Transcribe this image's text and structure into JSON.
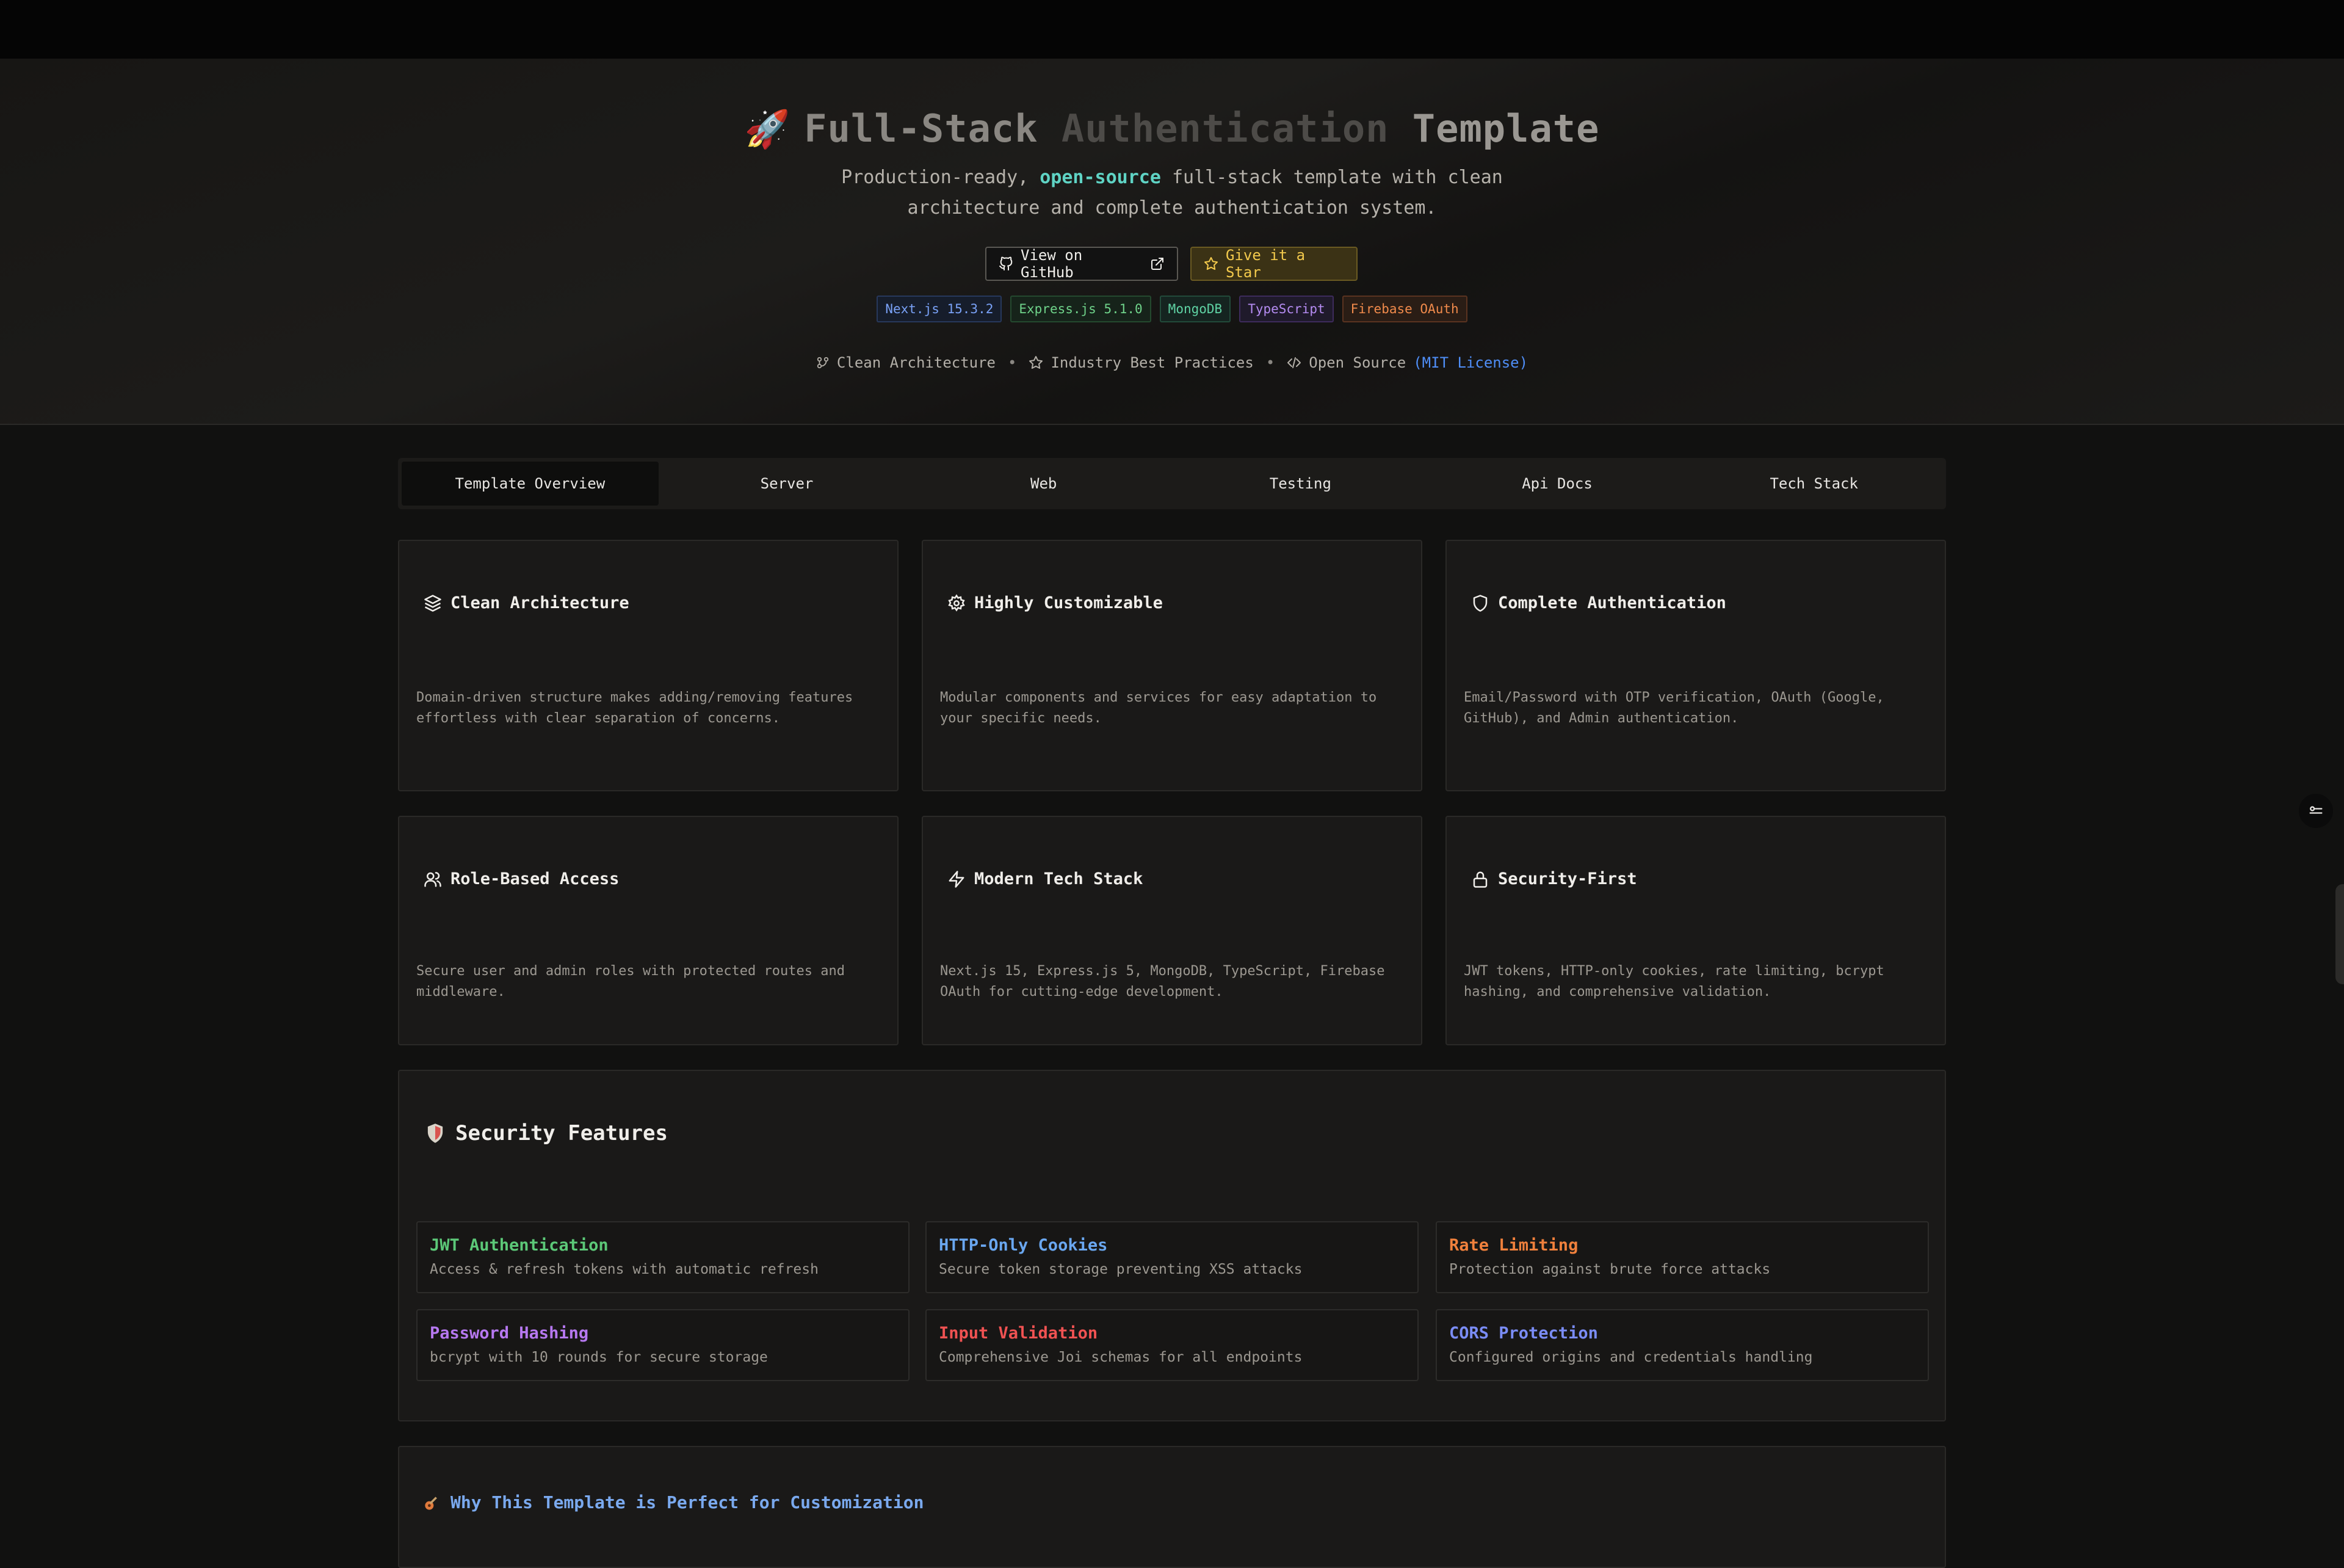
{
  "hero": {
    "title_part1": "Full-Stack ",
    "title_part2": "Authentication",
    "title_part3": " Template",
    "subtitle_before": "Production-ready, ",
    "subtitle_highlight": "open-source",
    "subtitle_after": " full-stack template with clean architecture and complete authentication system.",
    "github_button": "View on GitHub",
    "star_button": "Give it a Star",
    "badges": [
      {
        "label": "Next.js 15.3.2",
        "color": "#7aa2f7"
      },
      {
        "label": "Express.js 5.1.0",
        "color": "#6fd38a"
      },
      {
        "label": "MongoDB",
        "color": "#5fd3a4"
      },
      {
        "label": "TypeScript",
        "color": "#b58cf2"
      },
      {
        "label": "Firebase OAuth",
        "color": "#f08a4b"
      }
    ],
    "features": {
      "clean": "Clean Architecture",
      "best": "Industry Best Practices",
      "open": "Open Source",
      "license": "(MIT License)"
    }
  },
  "tabs": [
    "Template Overview",
    "Server",
    "Web",
    "Testing",
    "Api Docs",
    "Tech Stack"
  ],
  "cards": [
    {
      "title": "Clean Architecture",
      "icon": "layers-icon",
      "desc": "Domain-driven structure makes adding/removing features effortless with clear separation of concerns."
    },
    {
      "title": "Highly Customizable",
      "icon": "gear-icon",
      "desc": "Modular components and services for easy adaptation to your specific needs."
    },
    {
      "title": "Complete Authentication",
      "icon": "shield-icon",
      "desc": "Email/Password with OTP verification, OAuth (Google, GitHub), and Admin authentication."
    },
    {
      "title": "Role-Based Access",
      "icon": "users-icon",
      "desc": "Secure user and admin roles with protected routes and middleware."
    },
    {
      "title": "Modern Tech Stack",
      "icon": "lightning-icon",
      "desc": "Next.js 15, Express.js 5, MongoDB, TypeScript, Firebase OAuth for cutting-edge development."
    },
    {
      "title": "Security-First",
      "icon": "lock-icon",
      "desc": "JWT tokens, HTTP-only cookies, rate limiting, bcrypt hashing, and comprehensive validation."
    }
  ],
  "security": {
    "title": "Security Features",
    "items": [
      {
        "name": "JWT Authentication",
        "desc": "Access & refresh tokens with automatic refresh",
        "color": "#5cc878"
      },
      {
        "name": "HTTP-Only Cookies",
        "desc": "Secure token storage preventing XSS attacks",
        "color": "#6aa7f0"
      },
      {
        "name": "Rate Limiting",
        "desc": "Protection against brute force attacks",
        "color": "#f0803c"
      },
      {
        "name": "Password Hashing",
        "desc": "bcrypt with 10 rounds for secure storage",
        "color": "#b678f0"
      },
      {
        "name": "Input Validation",
        "desc": "Comprehensive Joi schemas for all endpoints",
        "color": "#f05252"
      },
      {
        "name": "CORS Protection",
        "desc": "Configured origins and credentials handling",
        "color": "#7a8cf5"
      }
    ]
  },
  "why": {
    "title": "Why This Template is Perfect for Customization"
  }
}
